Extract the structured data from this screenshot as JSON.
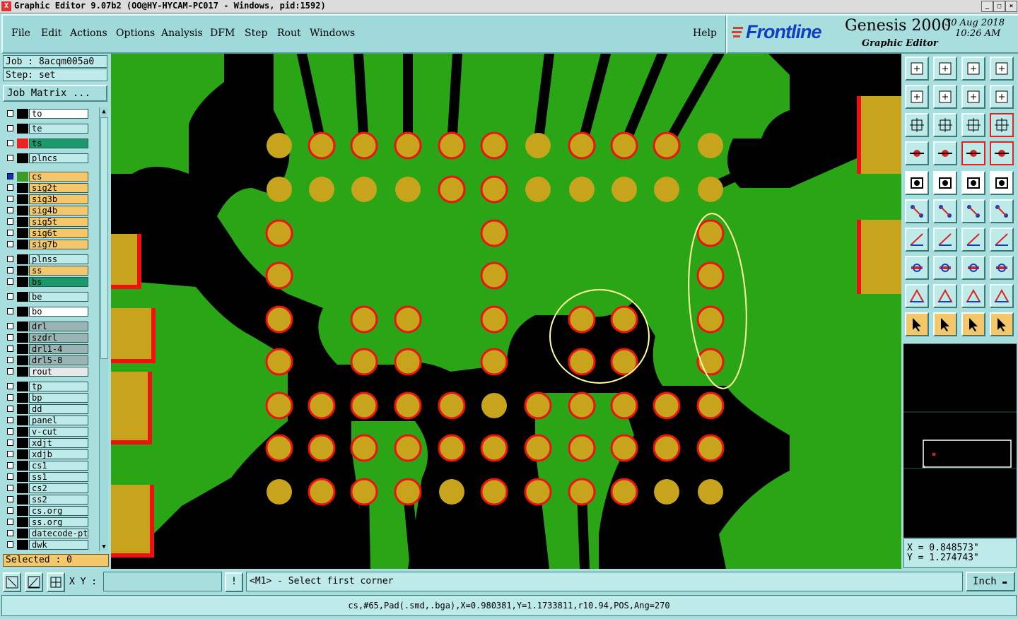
{
  "window": {
    "title": "Graphic Editor 9.07b2 (OO@HY-HYCAM-PC017 - Windows, pid:1592)",
    "app_icon": "X"
  },
  "menu": {
    "items": [
      "File",
      "Edit",
      "Actions",
      "Options",
      "Analysis",
      "DFM",
      "Step",
      "Rout",
      "Windows"
    ],
    "help": "Help"
  },
  "brand": {
    "logo": "Frontline",
    "product": "Genesis 2000",
    "subtitle": "Graphic Editor",
    "date": "30 Aug 2018",
    "time": "10:26 AM"
  },
  "job": {
    "job_line": "Job : 8acqm005a0",
    "step_line": "Step: set",
    "matrix_button": "Job Matrix ..."
  },
  "layers": [
    {
      "name": "to",
      "bg": "#ffffff",
      "sw": "#000000"
    },
    {
      "name": "te",
      "bg": "#bfeaea",
      "sw": "#000000"
    },
    {
      "name": "ts",
      "bg": "#1a9a6a",
      "sw": "#ee2222"
    },
    {
      "name": "plncs",
      "bg": "#bfeaea",
      "sw": "#000000"
    },
    {
      "name": "cs",
      "bg": "#f4c86a",
      "sw": "#3a9a2a",
      "active": true
    },
    {
      "name": "sig2t",
      "bg": "#f4c86a",
      "sw": "#000000"
    },
    {
      "name": "sig3b",
      "bg": "#f4c86a",
      "sw": "#000000"
    },
    {
      "name": "sig4b",
      "bg": "#f4c86a",
      "sw": "#000000"
    },
    {
      "name": "sig5t",
      "bg": "#f4c86a",
      "sw": "#000000"
    },
    {
      "name": "sig6t",
      "bg": "#f4c86a",
      "sw": "#000000"
    },
    {
      "name": "sig7b",
      "bg": "#f4c86a",
      "sw": "#000000"
    },
    {
      "name": "plnss",
      "bg": "#bfeaea",
      "sw": "#000000"
    },
    {
      "name": "ss",
      "bg": "#f4c86a",
      "sw": "#000000"
    },
    {
      "name": "bs",
      "bg": "#1a9a6a",
      "sw": "#000000"
    },
    {
      "name": "be",
      "bg": "#bfeaea",
      "sw": "#000000"
    },
    {
      "name": "bo",
      "bg": "#ffffff",
      "sw": "#000000"
    },
    {
      "name": "drl",
      "bg": "#9ab4b4",
      "sw": "#000000"
    },
    {
      "name": "szdrl",
      "bg": "#9ab4b4",
      "sw": "#000000"
    },
    {
      "name": "drl1-4",
      "bg": "#9ab4b4",
      "sw": "#000000"
    },
    {
      "name": "drl5-8",
      "bg": "#9ab4b4",
      "sw": "#000000"
    },
    {
      "name": "rout",
      "bg": "#e8e8e8",
      "sw": "#000000"
    },
    {
      "name": "tp",
      "bg": "#bfeaea",
      "sw": "#000000"
    },
    {
      "name": "bp",
      "bg": "#bfeaea",
      "sw": "#000000"
    },
    {
      "name": "dd",
      "bg": "#bfeaea",
      "sw": "#000000"
    },
    {
      "name": "panel",
      "bg": "#bfeaea",
      "sw": "#000000"
    },
    {
      "name": "v-cut",
      "bg": "#bfeaea",
      "sw": "#000000"
    },
    {
      "name": "xdjt",
      "bg": "#bfeaea",
      "sw": "#000000"
    },
    {
      "name": "xdjb",
      "bg": "#bfeaea",
      "sw": "#000000"
    },
    {
      "name": "cs1",
      "bg": "#bfeaea",
      "sw": "#000000"
    },
    {
      "name": "ss1",
      "bg": "#bfeaea",
      "sw": "#000000"
    },
    {
      "name": "cs2",
      "bg": "#bfeaea",
      "sw": "#000000"
    },
    {
      "name": "ss2",
      "bg": "#bfeaea",
      "sw": "#000000"
    },
    {
      "name": "cs.org",
      "bg": "#bfeaea",
      "sw": "#000000"
    },
    {
      "name": "ss.org",
      "bg": "#bfeaea",
      "sw": "#000000"
    },
    {
      "name": "datecode-ptc",
      "bg": "#bfeaea",
      "sw": "#000000"
    },
    {
      "name": "dwk",
      "bg": "#bfeaea",
      "sw": "#000000"
    }
  ],
  "selected": "Selected : 0",
  "coords": {
    "x": "X = 0.848573\"",
    "y": "Y = 1.274743\""
  },
  "bottom": {
    "xy_label": "X Y :",
    "xy_value": "",
    "prompt": "<M1> - Select first corner",
    "unit": "Inch",
    "info_button": "!"
  },
  "status": "cs,#65,Pad(.smd,.bga),X=0.980381,Y=1.1733811,r10.94,POS,Ang=270",
  "colors": {
    "board": "#2aa515",
    "pad": "#c8a41c",
    "clearance": "#ee1111",
    "highlight": "#ffffa0"
  },
  "tools": [
    "move-up-icon",
    "move-down-icon",
    "home-icon",
    "window-icon",
    "pan-left-icon",
    "pan-right-icon",
    "mirror-icon",
    "stretch-icon",
    "zoom-fit-icon",
    "zoom-center-icon",
    "scale-1to2-icon",
    "help-query-icon",
    "measure-icon",
    "probe-icon",
    "layers-color-icon",
    "layers-view-icon",
    "snapshot-icon",
    "shape-edit-icon",
    "ruler-icon",
    "dot-select-icon",
    "net-connect-icon",
    "snap-cross-icon",
    "line-diag-icon",
    "arc-snap-icon",
    "angle-icon",
    "slope-icon",
    "rotate-icon",
    "split-icon",
    "break-icon",
    "dash-icon",
    "fit-window-icon",
    "multi-select-icon",
    "triangle-red-icon",
    "triangle-blue-icon",
    "triangle-outline-icon",
    "triangle-fill-icon",
    "pointer-icon",
    "pointer-box-icon",
    "pointer-select-icon",
    "pointer-net-icon"
  ]
}
